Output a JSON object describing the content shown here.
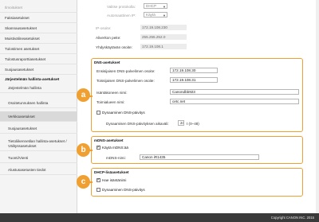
{
  "sidebar": {
    "items": [
      {
        "label": "Ilmoitukset"
      },
      {
        "label": "Faksiasetukset"
      },
      {
        "label": "Skannausasetukset"
      },
      {
        "label": "Muistivälineasetukset"
      },
      {
        "label": "Tulostimen asetukset"
      },
      {
        "label": "Tulostusraporttiasetukset"
      },
      {
        "label": "Suojausasetukset"
      },
      {
        "label": "Järjestelmän hallinta-asetukset"
      },
      {
        "label": "Järjestelmän hallinta"
      },
      {
        "label": "Osoitetunnuksen hallinta"
      },
      {
        "label": "Verkkoasetukset"
      },
      {
        "label": "Suojausasetukset"
      },
      {
        "label": "Tietoliikennetilan hallinta-asetukset / Välityssasetukset"
      },
      {
        "label": "Tuonti/Vienti"
      },
      {
        "label": "Alustusasetusten tiedot"
      }
    ]
  },
  "top": {
    "rows": [
      {
        "label": "Valitse protokolla:",
        "value": "DHCP"
      },
      {
        "label": "Automaattinen IP:",
        "value": "Käytä"
      },
      {
        "label": "IP-osoite:",
        "value": "172.19.108.230"
      },
      {
        "label": "Aliverkon peite:",
        "value": "255.255.252.0"
      },
      {
        "label": "Yhdyskäytävän osoite:",
        "value": "172.19.108.1"
      }
    ]
  },
  "dns": {
    "title": "DNS-asetukset",
    "primary_label": "Ensisijaisen DNS-palvelimen osoite:",
    "primary_value": "172.19.108.30",
    "secondary_label": "Toissijaisen DNS-palvelimen osoite:",
    "secondary_value": "172.19.108.31",
    "host_label": "Isäntäkoneen nimi:",
    "host_value": "Canondbb923",
    "domain_label": "Toimialueen nimi:",
    "domain_value": "cetc.net",
    "dyn_label": "Dynaaminen DNS-päivitys",
    "interval_label": "Dynaamisen DNS-päivityksen aikaväli:",
    "interval_value": "24",
    "interval_unit": "t (0–48)"
  },
  "mdns": {
    "title": "mDNS-asetukset",
    "use_label": "Käytä mDNS:ää",
    "name_label": "mDNS-nimi:",
    "name_value": "Canon iR1435"
  },
  "dhcp": {
    "title": "DHCP-lisäasetukset",
    "hostname_label": "Hae isäntänimi",
    "dyn_label": "Dynaaminen DNS-päivitys"
  },
  "badges": {
    "a": "a",
    "b": "b",
    "c": "c"
  },
  "footer": {
    "copyright": "Copyright CANON INC. 2015"
  },
  "colors": {
    "accent": "#f0a030",
    "footer_bg": "#3a3a3a"
  }
}
